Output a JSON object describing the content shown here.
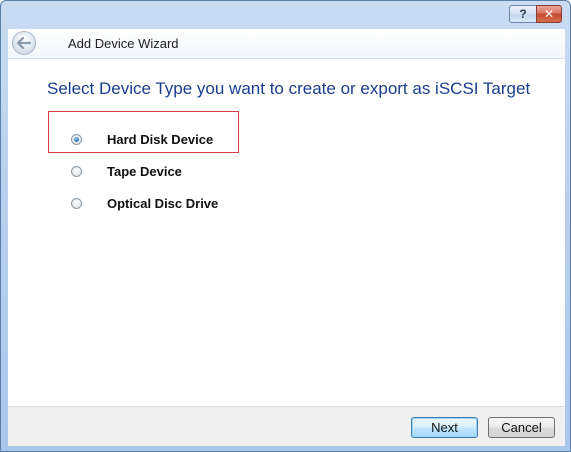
{
  "window": {
    "help_label": "?",
    "close_label": "✕"
  },
  "header": {
    "back_icon": "back-arrow-icon",
    "title": "Add Device Wizard"
  },
  "main": {
    "heading": "Select Device Type you want to create or export as iSCSI Target",
    "selected_index": 0,
    "options": [
      {
        "label": "Hard Disk Device",
        "checked": true
      },
      {
        "label": "Tape Device",
        "checked": false
      },
      {
        "label": "Optical Disc Drive",
        "checked": false
      }
    ]
  },
  "footer": {
    "next_label": "Next",
    "cancel_label": "Cancel"
  },
  "colors": {
    "heading": "#1a3e8c",
    "highlight_border": "#d73f3f",
    "frame": "#b9d1ef"
  }
}
